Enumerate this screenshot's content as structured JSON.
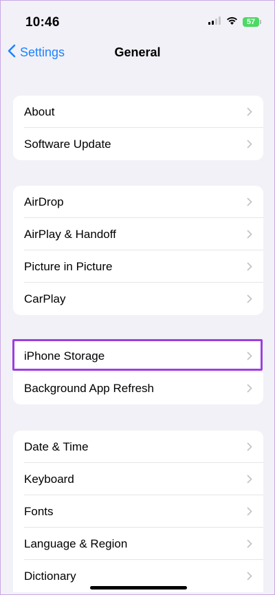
{
  "status": {
    "time": "10:46",
    "battery": "57"
  },
  "nav": {
    "back_label": "Settings",
    "title": "General"
  },
  "groups": [
    {
      "items": [
        {
          "label": "About"
        },
        {
          "label": "Software Update"
        }
      ]
    },
    {
      "items": [
        {
          "label": "AirDrop"
        },
        {
          "label": "AirPlay & Handoff"
        },
        {
          "label": "Picture in Picture"
        },
        {
          "label": "CarPlay"
        }
      ]
    },
    {
      "items": [
        {
          "label": "iPhone Storage"
        },
        {
          "label": "Background App Refresh"
        }
      ]
    },
    {
      "items": [
        {
          "label": "Date & Time"
        },
        {
          "label": "Keyboard"
        },
        {
          "label": "Fonts"
        },
        {
          "label": "Language & Region"
        },
        {
          "label": "Dictionary"
        }
      ]
    }
  ],
  "colors": {
    "accent": "#1a84ff",
    "highlight": "#9b3fde",
    "battery": "#4cd964",
    "background": "#f2f1f7"
  },
  "icons": [
    "signal-icon",
    "wifi-icon",
    "battery-icon",
    "back-chevron-icon",
    "chevron-right-icon"
  ]
}
